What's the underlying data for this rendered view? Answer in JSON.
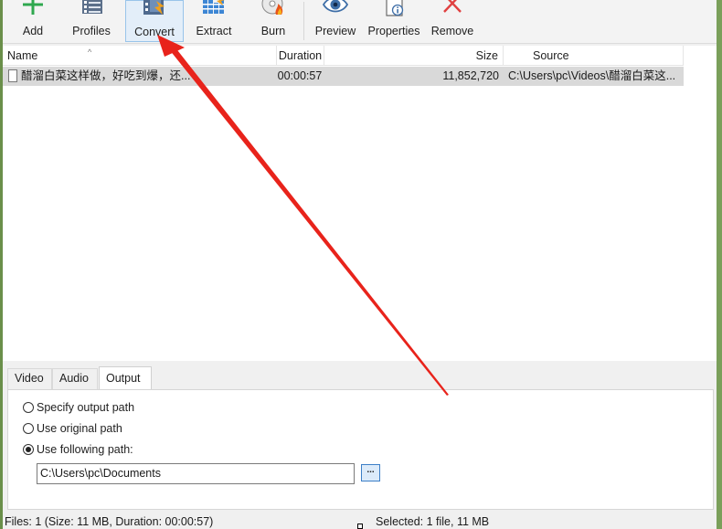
{
  "toolbar": {
    "buttons": [
      {
        "label": "Add",
        "icon": "plus-icon"
      },
      {
        "label": "Profiles",
        "icon": "film-list-icon"
      },
      {
        "label": "Convert",
        "icon": "film-convert-icon"
      },
      {
        "label": "Extract",
        "icon": "equalizer-icon"
      },
      {
        "label": "Burn",
        "icon": "disc-burn-icon"
      },
      {
        "label": "Preview",
        "icon": "eye-icon"
      },
      {
        "label": "Properties",
        "icon": "document-info-icon"
      },
      {
        "label": "Remove",
        "icon": "x-icon"
      }
    ],
    "active": "Convert"
  },
  "list": {
    "columns": [
      "Name",
      "Duration",
      "Size",
      "Source"
    ],
    "rows": [
      {
        "name": "醋溜白菜这样做，好吃到爆，还...",
        "duration": "00:00:57",
        "size": "11,852,720",
        "source": "C:\\Users\\pc\\Videos\\醋溜白菜这..."
      }
    ]
  },
  "tabs": {
    "items": [
      "Video",
      "Audio",
      "Output"
    ],
    "active": "Output"
  },
  "output": {
    "options": [
      "Specify output path",
      "Use original path",
      "Use following path:"
    ],
    "selected": "Use following path:",
    "path_value": "C:\\Users\\pc\\Documents",
    "browse_label": "..."
  },
  "status": {
    "left": "Files: 1 (Size: 11 MB, Duration: 00:00:57)",
    "right": "Selected: 1 file, 11 MB"
  },
  "colors": {
    "annotation_arrow": "#e8231b",
    "selected_row": "#d9d9d9",
    "active_button_bg": "#e3eef9",
    "plus_green": "#2fa84f",
    "remove_red": "#e04040"
  }
}
